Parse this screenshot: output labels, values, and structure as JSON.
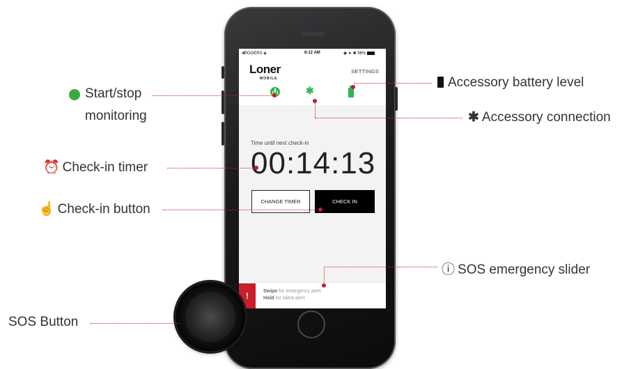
{
  "status_bar": {
    "carrier": "ROGERS",
    "time": "8:12 AM",
    "battery": "96%"
  },
  "app": {
    "logo": "Loner",
    "logo_sub": "MOBILE",
    "settings_label": "SETTINGS",
    "timer_caption": "Time until next check-in",
    "timer_value": "00:14:13",
    "change_timer_label": "CHANGE TIMER",
    "check_in_label": "CHECK IN",
    "sos_icon": "!",
    "sos_line1_bold": "Swipe",
    "sos_line1_rest": " for emergency alert",
    "sos_line2_bold": "Hold",
    "sos_line2_rest": " for silent alert"
  },
  "annotations": {
    "start_stop_line1": "Start/stop",
    "start_stop_line2": "monitoring",
    "accessory_battery": "Accessory battery level",
    "accessory_connection": "Accessory connection",
    "check_in_timer": "Check-in timer",
    "check_in_button": "Check-in button",
    "sos_slider": "SOS emergency slider",
    "sos_button": "SOS Button"
  },
  "icons": [
    "power-icon",
    "bluetooth-icon",
    "battery-icon",
    "alarm-clock-icon",
    "hand-pointer-icon",
    "exclamation-circle-icon"
  ],
  "colors": {
    "accent_green": "#2db84d",
    "sos_red": "#c8202a",
    "annotation_red": "#c02030"
  }
}
